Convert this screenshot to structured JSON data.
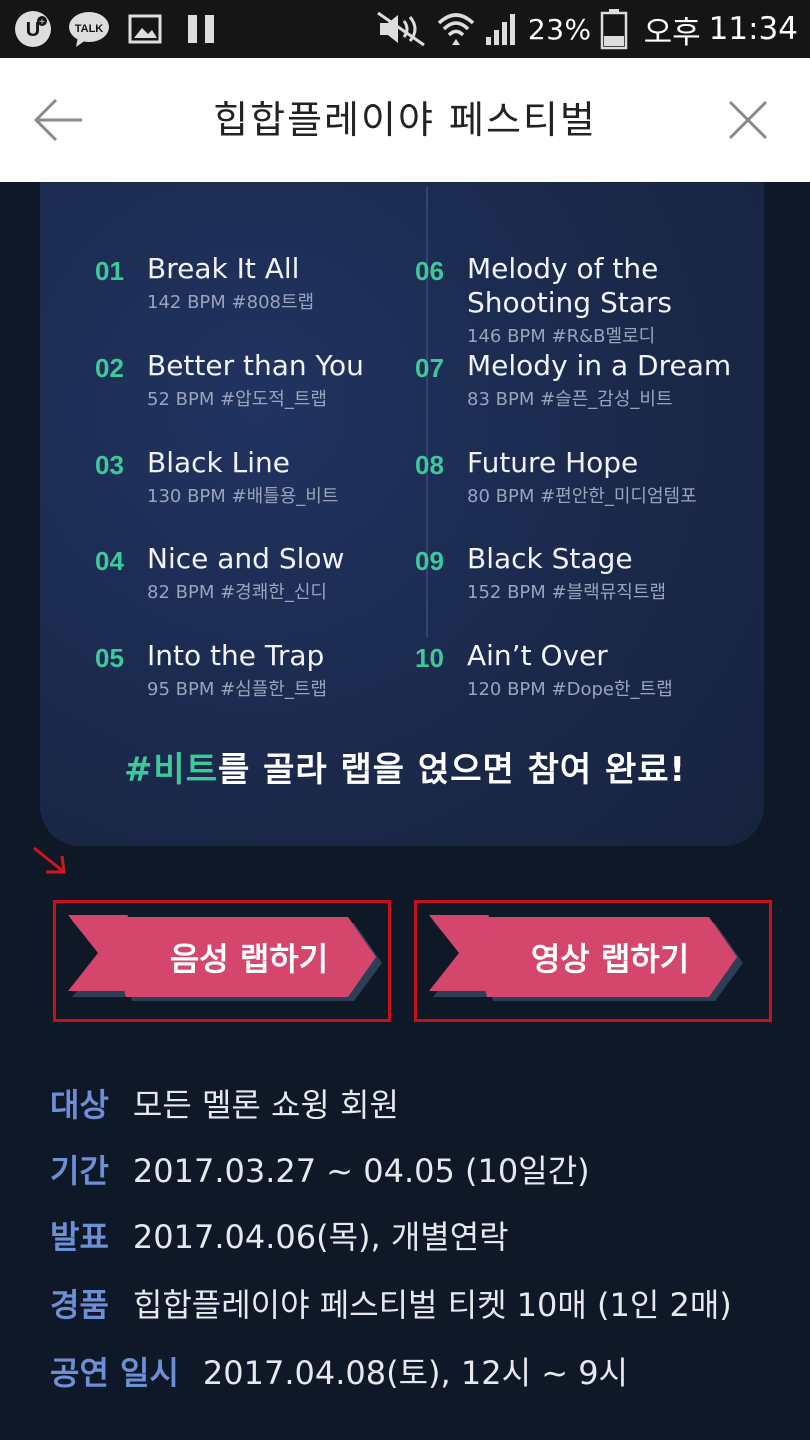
{
  "status_bar": {
    "battery": "23%",
    "period": "오후",
    "time": "11:34",
    "app_icons": [
      "uplus-icon",
      "kakaotalk-icon",
      "gallery-icon",
      "pause-icon"
    ]
  },
  "nav": {
    "title": "힙합플레이야 페스티벌"
  },
  "tracks": [
    {
      "num": "01",
      "title": "Break It All",
      "meta": "142 BPM #808트랩"
    },
    {
      "num": "02",
      "title": "Better than You",
      "meta": "52 BPM #압도적_트랩"
    },
    {
      "num": "03",
      "title": "Black Line",
      "meta": "130 BPM #배틀용_비트"
    },
    {
      "num": "04",
      "title": "Nice and Slow",
      "meta": "82 BPM #경쾌한_신디"
    },
    {
      "num": "05",
      "title": "Into the Trap",
      "meta": "95 BPM #심플한_트랩"
    },
    {
      "num": "06",
      "title": "Melody of the",
      "title2": "Shooting Stars",
      "meta": "146 BPM #R&B멜로디"
    },
    {
      "num": "07",
      "title": "Melody in a Dream",
      "meta": "83 BPM #슬픈_감성_비트"
    },
    {
      "num": "08",
      "title": "Future Hope",
      "meta": "80 BPM #편안한_미디엄템포"
    },
    {
      "num": "09",
      "title": "Black Stage",
      "meta": "152 BPM #블랙뮤직트랩"
    },
    {
      "num": "10",
      "title": "Ain’t Over",
      "meta": "120 BPM #Dope한_트랩"
    }
  ],
  "tagline": {
    "highlight": "#비트",
    "rest": "를 골라 랩을 얹으면 참여 완료!"
  },
  "buttons": {
    "voice": "음성 랩하기",
    "video": "영상 랩하기"
  },
  "info": [
    {
      "label": "대상",
      "value": "모든 멜론 쇼윙 회원"
    },
    {
      "label": "기간",
      "value": "2017.03.27 ~ 04.05 (10일간)"
    },
    {
      "label": "발표",
      "value": "2017.04.06(목), 개별연락"
    },
    {
      "label": "경품",
      "value": "힙합플레이야 페스티벌 티켓 10매 (1인 2매)"
    },
    {
      "label": "공연 일시",
      "value": "2017.04.08(토), 12시 ~ 9시"
    }
  ],
  "colors": {
    "accent_green": "#3ec99a",
    "ribbon_pink": "#d5466d",
    "label_blue": "#6d8fd6",
    "highlight_red": "#c4121b"
  }
}
